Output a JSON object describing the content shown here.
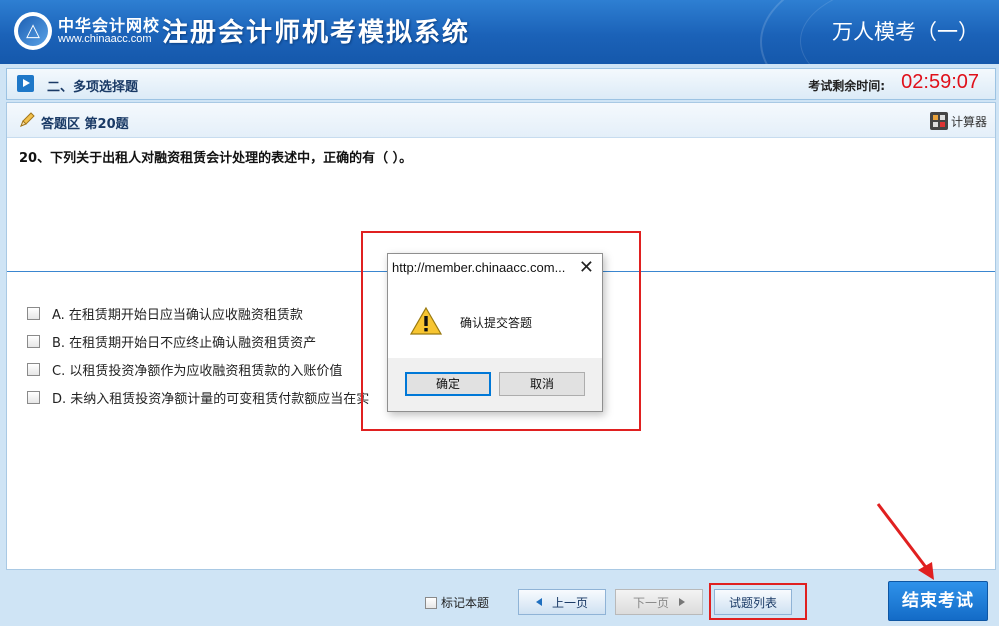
{
  "header": {
    "brand_cn": "中华会计网校",
    "brand_url": "www.chinaacc.com",
    "system_title": "注册会计师机考模拟系统",
    "exam_name": "万人模考（一）"
  },
  "section": {
    "title": "二、多项选择题",
    "timer_label": "考试剩余时间:",
    "timer_value": "02:59:07"
  },
  "answer_area": {
    "title": "答题区 第20题",
    "calculator_label": "计算器"
  },
  "question": {
    "text": "20、下列关于出租人对融资租赁会计处理的表述中，正确的有（   ）。",
    "options": [
      "A. 在租赁期开始日应当确认应收融资租赁款",
      "B. 在租赁期开始日不应终止确认融资租赁资产",
      "C. 以租赁投资净额作为应收融资租赁款的入账价值",
      "D. 未纳入租赁投资净额计量的可变租赁付款额应当在实"
    ]
  },
  "dialog": {
    "title": "http://member.chinaacc.com...",
    "close": "✕",
    "message": "确认提交答题",
    "ok_label": "确定",
    "cancel_label": "取消"
  },
  "footer": {
    "mark_label": "标记本题",
    "prev_label": "上一页",
    "next_label": "下一页",
    "list_label": "试题列表",
    "end_label": "结束考试"
  },
  "colors": {
    "header_blue": "#1b62b8",
    "timer_red": "#e0101a",
    "highlight_red": "#e02020",
    "end_button_blue": "#1f7fd8"
  }
}
